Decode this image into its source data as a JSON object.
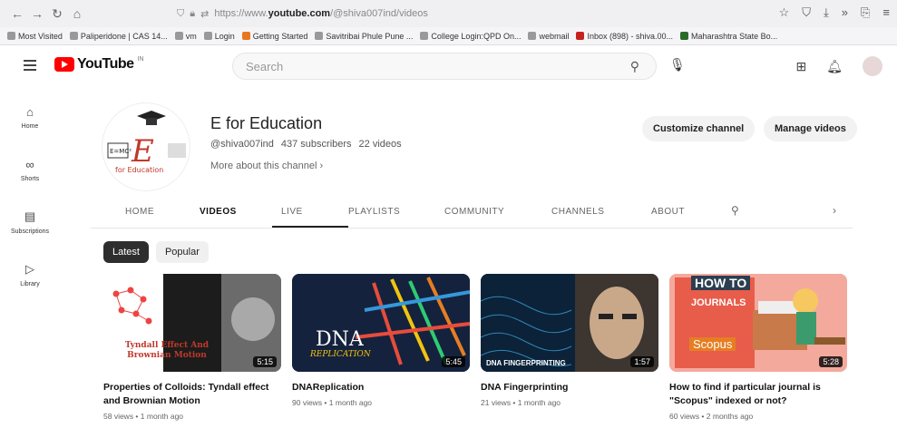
{
  "browser": {
    "url_prefix": "https://www.",
    "url_domain": "youtube.com",
    "url_path": "/@shiva007ind/videos",
    "bookmarks": [
      "Most Visited",
      "Paliperidone | CAS 14...",
      "vm",
      "Login",
      "Getting Started",
      "Savitribai Phule Pune ...",
      "College Login:QPD On...",
      "webmail",
      "Inbox (898) - shiva.00...",
      "Maharashtra State Bo..."
    ]
  },
  "header": {
    "logo_text": "YouTube",
    "logo_region": "IN",
    "search_placeholder": "Search"
  },
  "sidebar": {
    "items": [
      {
        "label": "Home",
        "icon": "home-icon"
      },
      {
        "label": "Shorts",
        "icon": "shorts-icon"
      },
      {
        "label": "Subscriptions",
        "icon": "subscriptions-icon"
      },
      {
        "label": "Library",
        "icon": "library-icon"
      }
    ]
  },
  "channel": {
    "name": "E for Education",
    "handle": "@shiva007ind",
    "subscribers": "437 subscribers",
    "videos_count": "22 videos",
    "more": "More about this channel",
    "logo_text": "E=MC²",
    "logo_sub": "for Education",
    "customize_label": "Customize channel",
    "manage_label": "Manage videos"
  },
  "tabs": [
    "HOME",
    "VIDEOS",
    "LIVE",
    "PLAYLISTS",
    "COMMUNITY",
    "CHANNELS",
    "ABOUT"
  ],
  "chips": [
    "Latest",
    "Popular"
  ],
  "videos": [
    {
      "title": "Properties of Colloids: Tyndall effect and Brownian Motion",
      "meta": "58 views • 1 month ago",
      "duration": "5:15",
      "thumb_text": "Tyndall Effect And Brownian Motion"
    },
    {
      "title": "DNAReplication",
      "meta": "90 views • 1 month ago",
      "duration": "5:45",
      "thumb_text": "DNA",
      "thumb_sub": "REPLICATION"
    },
    {
      "title": "DNA Fingerprinting",
      "meta": "21 views • 1 month ago",
      "duration": "1:57",
      "thumb_text": "DNA FINGERPRINTING"
    },
    {
      "title": "How to find if particular journal is \"Scopus\" indexed or not?",
      "meta": "60 views • 2 months ago",
      "duration": "5:28",
      "thumb_text": "HOW TO",
      "thumb_sub": "JOURNALS",
      "thumb_brand": "Scopus"
    }
  ]
}
